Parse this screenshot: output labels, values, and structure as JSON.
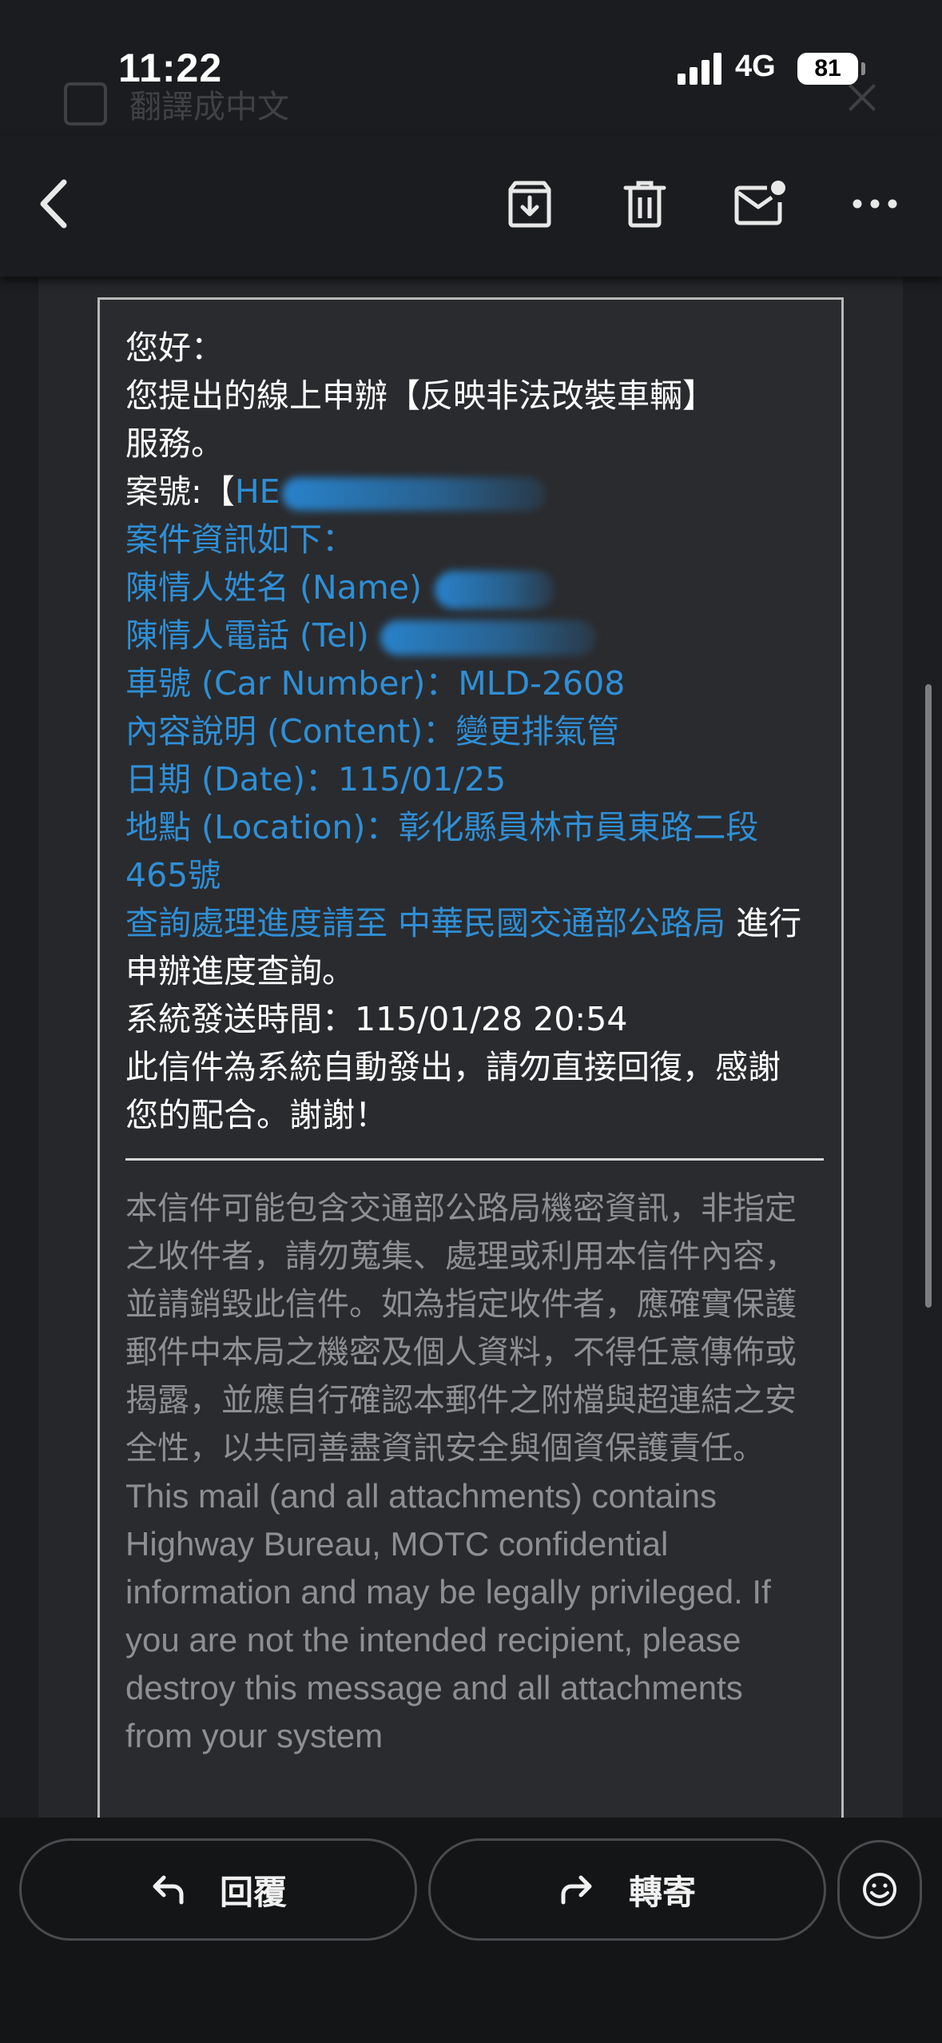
{
  "status_bar": {
    "time": "11:22",
    "network": "4G",
    "battery": "81",
    "ghost_translate_label": "翻譯成中文"
  },
  "toolbar": {
    "back_icon": "chevron-left-icon",
    "archive_icon": "archive-icon",
    "delete_icon": "trash-icon",
    "unread_icon": "mail-unread-icon",
    "more_icon": "more-horizontal-icon"
  },
  "email": {
    "greeting": "您好：",
    "intro_1": "您提出的線上申辦【反映非法改裝車輛】",
    "intro_2": "服務。",
    "case_prefix": "案號:【",
    "case_visible": "HE",
    "info_header": "案件資訊如下：",
    "name_label": "陳情人姓名 (Name)",
    "tel_label": "陳情人電話 (Tel)",
    "car_number": "車號 (Car Number)：MLD-2608",
    "content": "內容說明 (Content)：變更排氣管",
    "date": "日期 (Date)：115/01/25",
    "location": "地點 (Location)：彰化縣員林市員東路二段465號",
    "query_link": "查詢處理進度請至 中華民國交通部公路局",
    "query_suffix": " 進行申辦進度查詢。",
    "sent_time": "系統發送時間：115/01/28 20:54",
    "auto_notice": "此信件為系統自動發出，請勿直接回復，感謝您的配合。謝謝！",
    "disclaimer_zh": "本信件可能包含交通部公路局機密資訊，非指定之收件者，請勿蒐集、處理或利用本信件內容，並請銷毀此信件。如為指定收件者，應確實保護郵件中本局之機密及個人資料，不得任意傳佈或揭露，並應自行確認本郵件之附檔與超連結之安全性，以共同善盡資訊安全與個資保護責任。",
    "disclaimer_en": "This mail (and all attachments) contains Highway Bureau, MOTC confidential information and may be legally privileged. If you are not the intended recipient, please destroy this message and all attachments from your system"
  },
  "bottom_bar": {
    "reply_label": "回覆",
    "forward_label": "轉寄",
    "reply_icon": "reply-icon",
    "forward_icon": "forward-icon",
    "emoji_icon": "smiley-icon"
  },
  "colors": {
    "link_blue": "#2f8fd6",
    "disclaimer_gray": "#8e8f92",
    "toolbar_bg": "#1b1c1f"
  }
}
